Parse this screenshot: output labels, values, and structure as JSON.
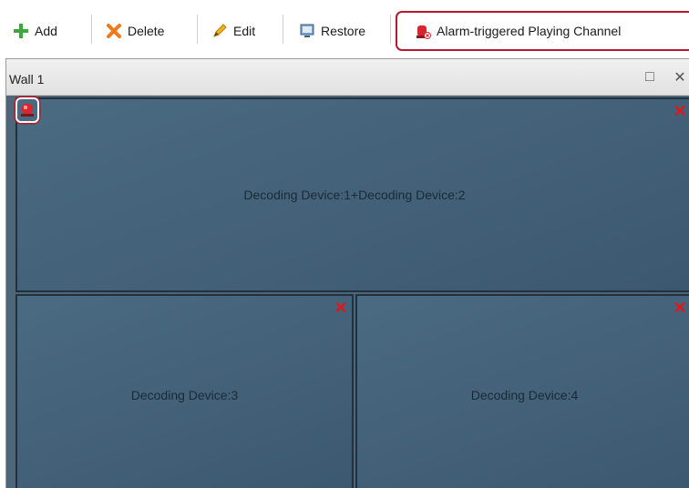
{
  "toolbar": {
    "add_label": "Add",
    "delete_label": "Delete",
    "edit_label": "Edit",
    "restore_label": "Restore",
    "alarm_label": "Alarm-triggered Playing Channel"
  },
  "wall": {
    "title": "Wall 1",
    "maximize_glyph": "□",
    "close_glyph": "✕"
  },
  "cells": [
    {
      "label": "Decoding Device:1+Decoding Device:2"
    },
    {
      "label": "Decoding Device:3"
    },
    {
      "label": "Decoding Device:4"
    }
  ],
  "colors": {
    "highlight_border": "#b51c2a",
    "remove_x": "#e01818",
    "cell_bg": "#4a6b82"
  },
  "icons": [
    "add-icon",
    "delete-icon",
    "edit-icon",
    "restore-icon",
    "alarm-icon",
    "maximize-icon",
    "close-icon",
    "remove-cell-icon"
  ]
}
